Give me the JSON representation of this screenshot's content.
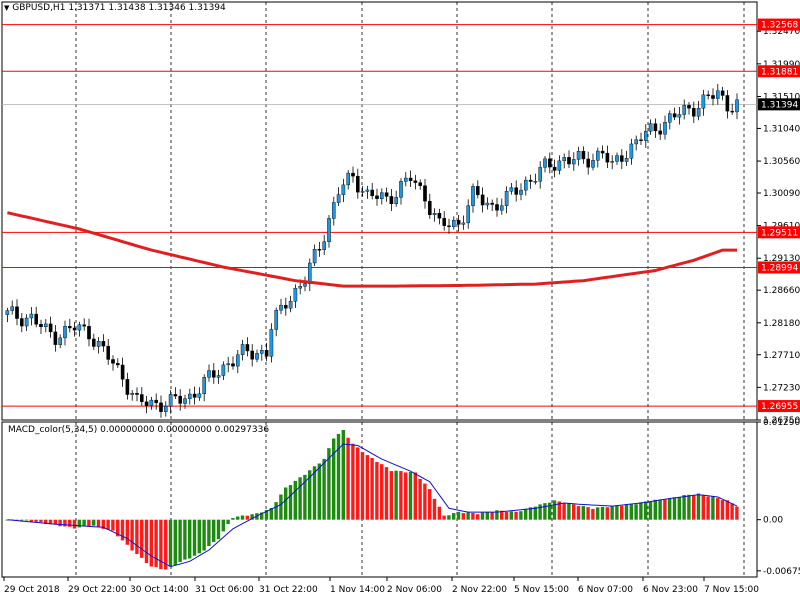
{
  "header": {
    "symbol_label": "GBPUSD,H1",
    "ohlc": "1.31371 1.31438 1.31346 1.31394",
    "collapse_glyph": "▼"
  },
  "macd_header": "MACD_color(5,34,5) 0.00000000 0.00000000 0.00297336",
  "colors": {
    "bull": "#1f8a12",
    "bear": "#ff1a1a",
    "ma": "#e02020",
    "hline": "#ff0000",
    "signal": "#1010cc",
    "grid": "#000000",
    "current": "#000000"
  },
  "chart_data": [
    {
      "type": "candlestick",
      "title": "GBPUSD,H1",
      "ylim": [
        1.2675,
        1.329
      ],
      "y_ticks": [
        "1.32470",
        "1.31990",
        "1.31510",
        "1.31040",
        "1.30560",
        "1.30090",
        "1.29610",
        "1.29130",
        "1.28660",
        "1.28180",
        "1.27710",
        "1.27230",
        "1.26750"
      ],
      "x_tick_labels": [
        "29 Oct 2018",
        "29 Oct 22:00",
        "30 Oct 14:00",
        "31 Oct 06:00",
        "31 Oct 22:00",
        "1 Nov 14:00",
        "2 Nov 06:00",
        "2 Nov 22:00",
        "5 Nov 15:00",
        "6 Nov 07:00",
        "6 Nov 23:00",
        "7 Nov 15:00"
      ],
      "horizontal_levels": [
        {
          "value": 1.32568,
          "label": "1.32568"
        },
        {
          "value": 1.31881,
          "label": "1.31881"
        },
        {
          "value": 1.29511,
          "label": "1.29511"
        },
        {
          "value": 1.28994,
          "label": "1.28994"
        },
        {
          "value": 1.26955,
          "label": "1.26955"
        }
      ],
      "current_price": {
        "value": 1.31394,
        "label": "1.31394"
      },
      "close_anchors": [
        [
          0,
          1.283
        ],
        [
          5,
          1.2825
        ],
        [
          8,
          1.2805
        ],
        [
          10,
          1.28
        ],
        [
          14,
          1.281
        ],
        [
          17,
          1.2805
        ],
        [
          20,
          1.2775
        ],
        [
          24,
          1.274
        ],
        [
          27,
          1.27
        ],
        [
          30,
          1.27
        ],
        [
          34,
          1.27
        ],
        [
          38,
          1.271
        ],
        [
          42,
          1.2735
        ],
        [
          46,
          1.276
        ],
        [
          50,
          1.2775
        ],
        [
          54,
          1.2775
        ],
        [
          55,
          1.281
        ],
        [
          58,
          1.285
        ],
        [
          62,
          1.288
        ],
        [
          66,
          1.295
        ],
        [
          69,
          1.301
        ],
        [
          72,
          1.3035
        ],
        [
          75,
          1.3005
        ],
        [
          79,
          1.3
        ],
        [
          84,
          1.303
        ],
        [
          87,
          1.3005
        ],
        [
          90,
          1.296
        ],
        [
          94,
          1.2965
        ],
        [
          97,
          1.3005
        ],
        [
          101,
          1.299
        ],
        [
          104,
          1.3
        ],
        [
          108,
          1.3025
        ],
        [
          112,
          1.3045
        ],
        [
          116,
          1.306
        ],
        [
          120,
          1.3055
        ],
        [
          124,
          1.307
        ],
        [
          126,
          1.3045
        ],
        [
          128,
          1.3065
        ],
        [
          132,
          1.309
        ],
        [
          136,
          1.311
        ],
        [
          140,
          1.3125
        ],
        [
          144,
          1.314
        ],
        [
          148,
          1.3155
        ],
        [
          150,
          1.314
        ],
        [
          152,
          1.3139
        ]
      ],
      "moving_average_anchors": [
        [
          0,
          1.298
        ],
        [
          15,
          1.2956
        ],
        [
          30,
          1.2925
        ],
        [
          45,
          1.29
        ],
        [
          60,
          1.288
        ],
        [
          70,
          1.2872
        ],
        [
          80,
          1.2872
        ],
        [
          95,
          1.2873
        ],
        [
          110,
          1.2875
        ],
        [
          120,
          1.288
        ],
        [
          135,
          1.2895
        ],
        [
          143,
          1.291
        ],
        [
          149,
          1.2925
        ]
      ]
    },
    {
      "type": "histogram",
      "title": "MACD_color(5,34,5)",
      "ylim": [
        -0.00757,
        0.012903
      ],
      "y_tick_labels": [
        "0.012903",
        "0.00",
        "-0.006757"
      ],
      "anchors": [
        [
          0,
          0.0
        ],
        [
          5,
          -0.0002
        ],
        [
          10,
          -0.0007
        ],
        [
          14,
          -0.0011
        ],
        [
          18,
          -0.0008
        ],
        [
          22,
          -0.0015
        ],
        [
          26,
          -0.004
        ],
        [
          30,
          -0.0062
        ],
        [
          33,
          -0.0066
        ],
        [
          36,
          -0.0056
        ],
        [
          40,
          -0.0045
        ],
        [
          44,
          -0.0025
        ],
        [
          47,
          0.0003
        ],
        [
          52,
          0.0008
        ],
        [
          55,
          0.0015
        ],
        [
          58,
          0.0042
        ],
        [
          62,
          0.006
        ],
        [
          66,
          0.008
        ],
        [
          68,
          0.0108
        ],
        [
          70,
          0.0118
        ],
        [
          72,
          0.01
        ],
        [
          75,
          0.0085
        ],
        [
          80,
          0.0065
        ],
        [
          85,
          0.0062
        ],
        [
          88,
          0.004
        ],
        [
          91,
          0.0005
        ],
        [
          94,
          0.001
        ],
        [
          98,
          0.0008
        ],
        [
          102,
          0.0012
        ],
        [
          106,
          0.001
        ],
        [
          110,
          0.0018
        ],
        [
          114,
          0.0025
        ],
        [
          118,
          0.002
        ],
        [
          122,
          0.0015
        ],
        [
          126,
          0.0018
        ],
        [
          130,
          0.002
        ],
        [
          134,
          0.0025
        ],
        [
          138,
          0.0028
        ],
        [
          141,
          0.0032
        ],
        [
          144,
          0.0034
        ],
        [
          147,
          0.003
        ],
        [
          150,
          0.0025
        ],
        [
          152,
          0.0018
        ]
      ],
      "signal_anchors": [
        [
          0,
          0.0
        ],
        [
          10,
          -0.0006
        ],
        [
          20,
          -0.001
        ],
        [
          25,
          -0.0025
        ],
        [
          30,
          -0.0048
        ],
        [
          34,
          -0.0062
        ],
        [
          38,
          -0.0055
        ],
        [
          42,
          -0.004
        ],
        [
          47,
          -0.0012
        ],
        [
          52,
          0.0005
        ],
        [
          57,
          0.002
        ],
        [
          62,
          0.005
        ],
        [
          66,
          0.0075
        ],
        [
          70,
          0.01
        ],
        [
          73,
          0.0098
        ],
        [
          78,
          0.008
        ],
        [
          84,
          0.0064
        ],
        [
          88,
          0.005
        ],
        [
          92,
          0.0015
        ],
        [
          96,
          0.001
        ],
        [
          102,
          0.001
        ],
        [
          110,
          0.0015
        ],
        [
          116,
          0.0022
        ],
        [
          120,
          0.002
        ],
        [
          126,
          0.0018
        ],
        [
          132,
          0.0022
        ],
        [
          138,
          0.0028
        ],
        [
          144,
          0.0033
        ],
        [
          148,
          0.003
        ],
        [
          152,
          0.0018
        ]
      ]
    }
  ]
}
